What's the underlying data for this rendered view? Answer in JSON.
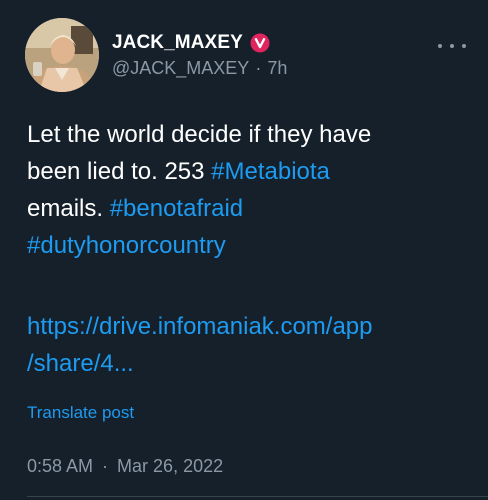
{
  "author": {
    "display_name": "JACK_MAXEY",
    "handle": "@JACK_MAXEY",
    "separator": "·",
    "relative_time": "7h"
  },
  "post": {
    "line1": "Let the world decide if they have",
    "line2_prefix": "been lied to. 253 ",
    "hashtag_metabiota": "#Metabiota",
    "line3_prefix": "emails. ",
    "hashtag_benotafraid": "#benotafraid",
    "hashtag_dutyhonorcountry": "#dutyhonorcountry",
    "url_line1": "https://drive.infomaniak.com/app",
    "url_line2": "/share/4..."
  },
  "actions": {
    "translate_label": "Translate post"
  },
  "meta": {
    "time": "0:58 AM",
    "separator": "·",
    "date": "Mar 26, 2022"
  },
  "colors": {
    "background": "#15202b",
    "link": "#1d9bf0",
    "muted": "#8b98a5",
    "badge": "#e0245e"
  },
  "icons": {
    "badge": "verified-badge-icon",
    "more": "more-icon"
  }
}
